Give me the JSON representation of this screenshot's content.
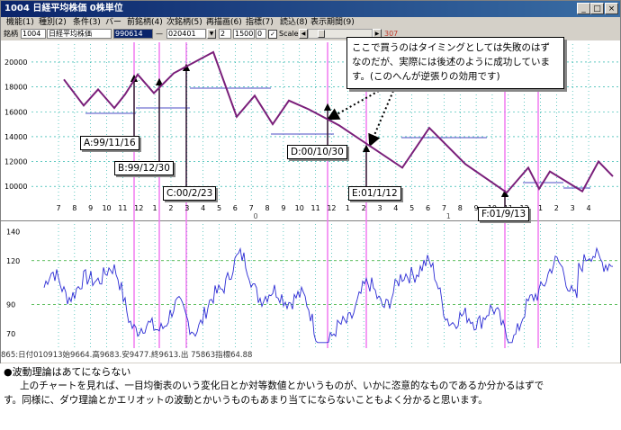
{
  "window": {
    "title": "1004 日経平均株価 0株単位",
    "buttons": {
      "minimize": "_",
      "maximize": "□",
      "close": "×"
    }
  },
  "menu": [
    "機能(1)",
    "種別(2)",
    "条件(3)",
    "バー",
    "前銘柄(4)",
    "次銘柄(5)",
    "再描画(6)",
    "指標(7)",
    "読込(8)",
    "表示期間(9)"
  ],
  "toolbar": {
    "code_label": "銘柄",
    "code": "1004",
    "name": "日経平均株価",
    "date_from": "990614",
    "date_to": "020401",
    "field_a": "2",
    "field_b": "1500",
    "field_c": "0",
    "scale_checked": "✓",
    "scale_label": "Scale",
    "right_value": "307"
  },
  "annotations": {
    "note": "ここで買うのはタイミングとしては失敗のはずなのだが、実際には後述のように成功しています。(このへんが逆張りの効用です)",
    "labels": {
      "a": "A:99/11/16",
      "b": "B:99/12/30",
      "c": "C:00/2/23",
      "d": "D:00/10/30",
      "e": "E:01/1/12",
      "f": "F:01/9/13"
    }
  },
  "status_line": "865:日付010913始9664.高9683.安9477.終9613.出 75863指標64.88",
  "caption": {
    "heading": "●波動理論はあてにならない",
    "body1": "上のチャートを見れば、一目均衡表のいう変化日とか対等数値とかいうものが、いかに恣意的なものであるか分かるはずで",
    "body2": "す。同様に、ダウ理論とかエリオットの波動とかいうものもあまり当てにならないこともよく分かると思います。"
  },
  "colors": {
    "wave": "#7a1f7a",
    "indicator": "#2b2bd4",
    "marker": "#f07af0",
    "grid": "#00a89c",
    "hline": "#7070d0"
  },
  "chart_data": [
    {
      "type": "line",
      "series": [
        {
          "values": [
            18600,
            16500,
            17800,
            16300,
            17400,
            19000,
            17500,
            19100,
            20800,
            15600,
            17300,
            15000,
            16900,
            16200,
            14900,
            11500,
            14700,
            11800,
            9500,
            11500,
            9800,
            11200,
            9600,
            12000,
            10800
          ]
        }
      ],
      "x_month_labels": [
        "7",
        "8",
        "9",
        "10",
        "11",
        "12",
        "1",
        "2",
        "3",
        "4",
        "5",
        "6",
        "7",
        "8",
        "9",
        "10",
        "11",
        "12",
        "1",
        "2",
        "3",
        "4",
        "5",
        "6",
        "7",
        "8",
        "9",
        "10",
        "11",
        "12",
        "1",
        "2",
        "3",
        "4"
      ],
      "year_labels": [
        "0",
        "1",
        "2"
      ],
      "y_ticks": [
        20000,
        18000,
        16000,
        14000,
        12000,
        10000
      ],
      "ylim": [
        9000,
        21300
      ]
    },
    {
      "type": "line",
      "y_ticks": [
        140,
        120,
        90,
        70
      ],
      "ylim": [
        62,
        142
      ]
    }
  ]
}
